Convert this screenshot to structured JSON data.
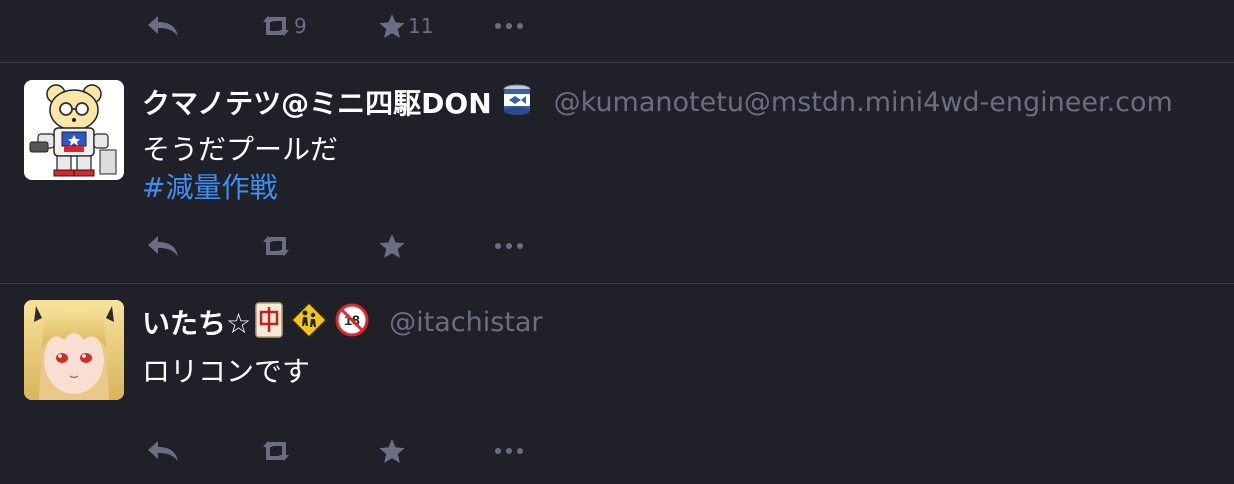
{
  "top_action_bar": {
    "boost_count": "9",
    "favourite_count": "11"
  },
  "statuses": [
    {
      "display_name": "クマノテツ@ミニ四駆DON",
      "name_emoji": [
        "canned-fish-emoji"
      ],
      "handle": "@kumanotetu@mstdn.mini4wd-engineer.com",
      "content_lines": [
        "そうだプールだ"
      ],
      "hashtag": "#減量作戦",
      "boost_count": "",
      "favourite_count": ""
    },
    {
      "display_name": "いたち☆",
      "name_emoji": [
        "mahjong-red-dragon-emoji",
        "children-crossing-emoji",
        "no-one-under-eighteen-emoji"
      ],
      "handle": "@itachistar",
      "content_lines": [
        "ロリコンです"
      ],
      "boost_count": "",
      "favourite_count": ""
    }
  ],
  "icons": {
    "reply": "reply-icon",
    "boost": "boost-icon",
    "favourite": "star-icon",
    "more": "more-icon"
  },
  "colors": {
    "background": "#1f2028",
    "divider": "#3a3c4a",
    "muted": "#6b6e82",
    "hashtag": "#3d8ff0",
    "text": "#ffffff"
  }
}
